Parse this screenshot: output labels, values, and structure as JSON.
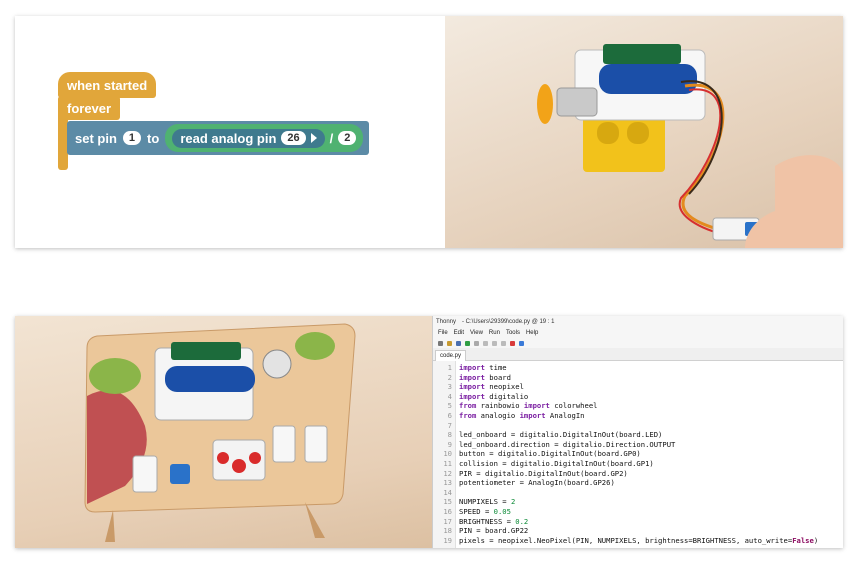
{
  "blocks": {
    "when_started": "when started",
    "forever": "forever",
    "set_pin": "set pin",
    "pin_value": "1",
    "to": "to",
    "read_analog_pin": "read analog pin",
    "analog_pin_value": "26",
    "divide": "/",
    "divisor": "2"
  },
  "ide": {
    "title_app": "Thonny",
    "title_path": "- C:\\Users\\29399\\code.py @ 19 : 1",
    "menu": [
      "File",
      "Edit",
      "View",
      "Run",
      "Tools",
      "Help"
    ],
    "tab": "code.py",
    "lines": [
      {
        "n": "1",
        "segs": [
          {
            "t": "import",
            "c": "kw"
          },
          {
            "t": " time"
          }
        ]
      },
      {
        "n": "2",
        "segs": [
          {
            "t": "import",
            "c": "kw"
          },
          {
            "t": " board"
          }
        ]
      },
      {
        "n": "3",
        "segs": [
          {
            "t": "import",
            "c": "kw"
          },
          {
            "t": " neopixel"
          }
        ]
      },
      {
        "n": "4",
        "segs": [
          {
            "t": "import",
            "c": "kw"
          },
          {
            "t": " digitalio"
          }
        ]
      },
      {
        "n": "5",
        "segs": [
          {
            "t": "from",
            "c": "kw"
          },
          {
            "t": " rainbowio "
          },
          {
            "t": "import",
            "c": "kw"
          },
          {
            "t": " colorwheel"
          }
        ]
      },
      {
        "n": "6",
        "segs": [
          {
            "t": "from",
            "c": "kw"
          },
          {
            "t": " analogio "
          },
          {
            "t": "import",
            "c": "kw"
          },
          {
            "t": " AnalogIn"
          }
        ]
      },
      {
        "n": "7",
        "segs": [
          {
            "t": ""
          }
        ]
      },
      {
        "n": "8",
        "segs": [
          {
            "t": "led_onboard = digitalio.DigitalInOut(board.LED)"
          }
        ]
      },
      {
        "n": "9",
        "segs": [
          {
            "t": "led_onboard.direction = digitalio.Direction.OUTPUT"
          }
        ]
      },
      {
        "n": "10",
        "segs": [
          {
            "t": "button = digitalio.DigitalInOut(board.GP0)"
          }
        ]
      },
      {
        "n": "11",
        "segs": [
          {
            "t": "collision = digitalio.DigitalInOut(board.GP1)"
          }
        ]
      },
      {
        "n": "12",
        "segs": [
          {
            "t": "PIR = digitalio.DigitalInOut(board.GP2)"
          }
        ]
      },
      {
        "n": "13",
        "segs": [
          {
            "t": "potentiometer = AnalogIn(board.GP26)"
          }
        ]
      },
      {
        "n": "14",
        "segs": [
          {
            "t": ""
          }
        ]
      },
      {
        "n": "15",
        "segs": [
          {
            "t": "NUMPIXELS = "
          },
          {
            "t": "2",
            "c": "nm"
          }
        ]
      },
      {
        "n": "16",
        "segs": [
          {
            "t": "SPEED = "
          },
          {
            "t": "0.05",
            "c": "nm"
          }
        ]
      },
      {
        "n": "17",
        "segs": [
          {
            "t": "BRIGHTNESS = "
          },
          {
            "t": "0.2",
            "c": "nm"
          }
        ]
      },
      {
        "n": "18",
        "segs": [
          {
            "t": "PIN = board.GP22"
          }
        ]
      },
      {
        "n": "19",
        "segs": [
          {
            "t": "pixels = neopixel.NeoPixel(PIN, NUMPIXELS, brightness=BRIGHTNESS, auto_write="
          },
          {
            "t": "False",
            "c": "ky"
          },
          {
            "t": ")"
          }
        ]
      }
    ]
  },
  "colors": {
    "hat": "#e1a63a",
    "set_pin": "#5c8ba6",
    "green_block": "#4fb271",
    "read_block": "#3f7a8e"
  }
}
